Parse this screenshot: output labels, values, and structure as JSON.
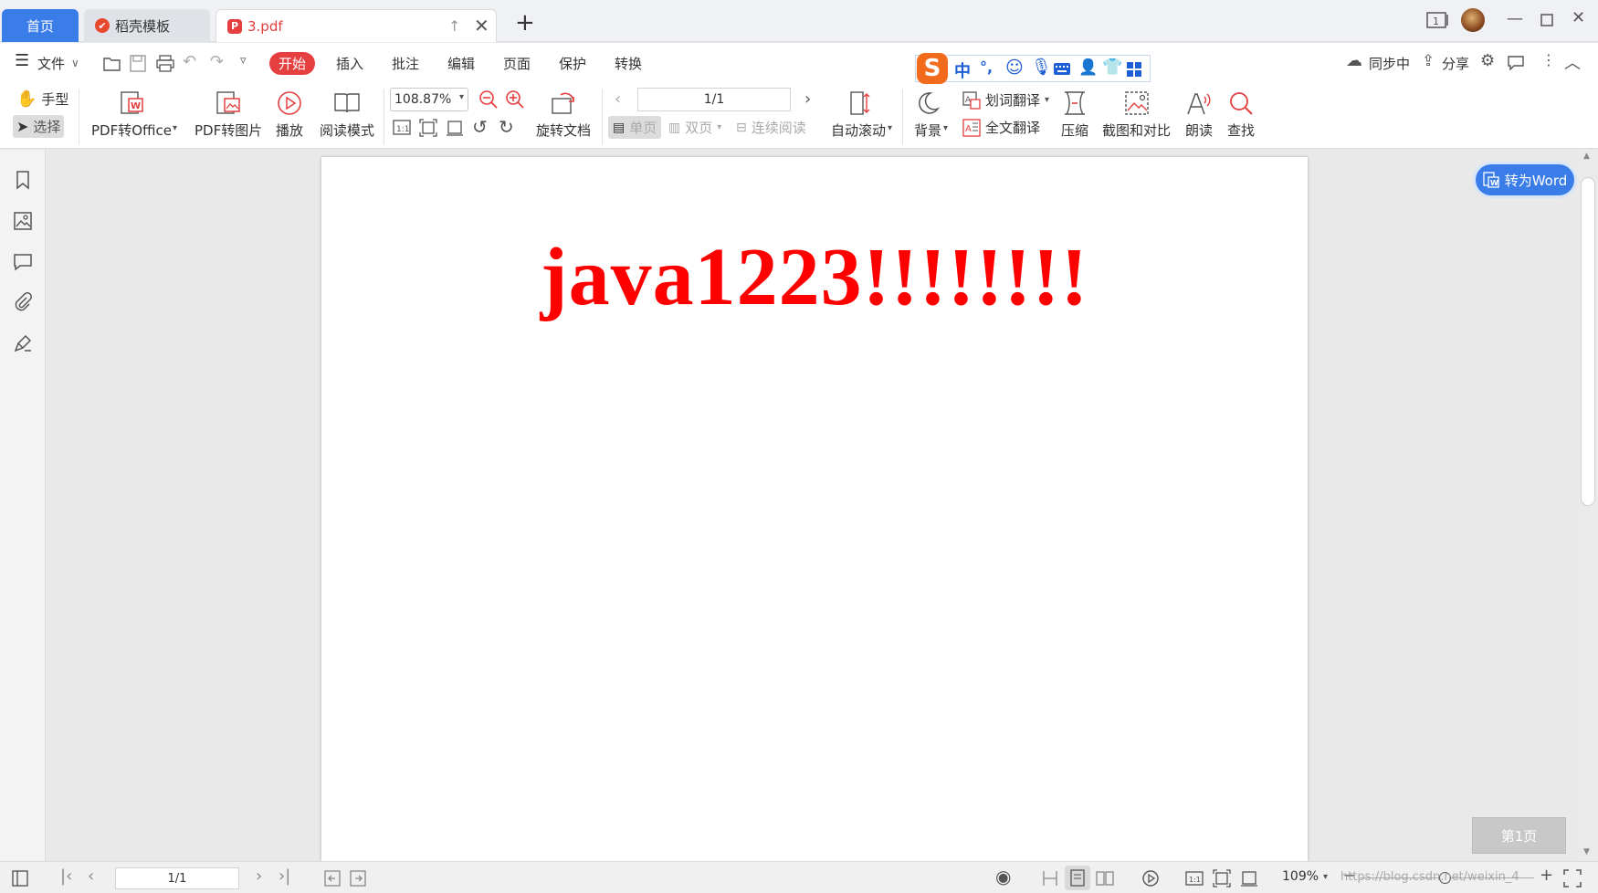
{
  "tabs": {
    "home": "首页",
    "template": "稻壳模板",
    "pdf": "3.pdf"
  },
  "menu": {
    "file": "文件",
    "start": "开始",
    "insert": "插入",
    "annotate": "批注",
    "edit": "编辑",
    "page": "页面",
    "protect": "保护",
    "convert": "转换"
  },
  "top_right": {
    "sync": "同步中",
    "share": "分享"
  },
  "ime": {
    "lang": "中",
    "punct": "°,"
  },
  "ribbon": {
    "hand": "手型",
    "select": "选择",
    "pdf_to_office": "PDF转Office",
    "pdf_to_image": "PDF转图片",
    "play": "播放",
    "read_mode": "阅读模式",
    "zoom_value": "108.87%",
    "rotate_doc": "旋转文档",
    "page_nav": "1/1",
    "single": "单页",
    "double": "双页",
    "continuous": "连续阅读",
    "auto_scroll": "自动滚动",
    "background": "背景",
    "word_translate": "划词翻译",
    "full_translate": "全文翻译",
    "compress": "压缩",
    "screenshot_compare": "截图和对比",
    "read_aloud": "朗读",
    "find": "查找"
  },
  "document": {
    "text": "java1223!!!!!!!!"
  },
  "convert_word": "转为Word",
  "page_badge": "第1页",
  "status": {
    "page_input": "1/1",
    "zoom": "109%",
    "watermark": "https://blog.csdn.net/weixin_4"
  },
  "colors": {
    "accent": "#3b7de8",
    "start_tab": "#e53f3f",
    "doc_text": "#ff0000"
  }
}
